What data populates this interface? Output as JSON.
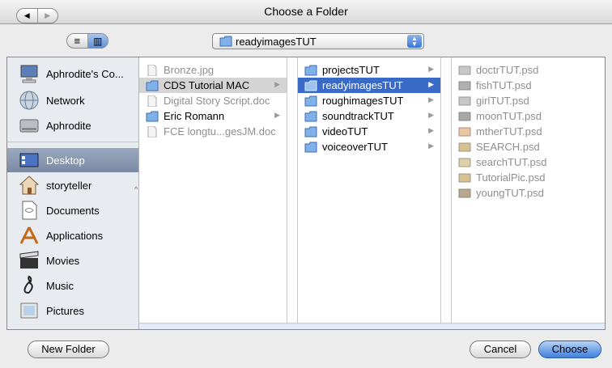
{
  "window": {
    "title": "Choose a Folder"
  },
  "toolbar": {
    "back_glyph": "◀",
    "forward_glyph": "▶",
    "list_view_glyph": "≡",
    "column_view_glyph": "▥",
    "path_popup": {
      "selected": "readyimagesTUT",
      "icon": "folder-icon"
    }
  },
  "sidebar": {
    "items": [
      {
        "label": "Aphrodite's Co...",
        "icon": "computer-icon"
      },
      {
        "label": "Network",
        "icon": "network-globe-icon"
      },
      {
        "label": "Aphrodite",
        "icon": "hard-disk-icon"
      },
      {
        "label": "Desktop",
        "icon": "desktop-icon",
        "selected": true
      },
      {
        "label": "storyteller",
        "icon": "home-icon"
      },
      {
        "label": "Documents",
        "icon": "documents-icon"
      },
      {
        "label": "Applications",
        "icon": "applications-icon"
      },
      {
        "label": "Movies",
        "icon": "movies-icon"
      },
      {
        "label": "Music",
        "icon": "music-icon"
      },
      {
        "label": "Pictures",
        "icon": "pictures-icon"
      }
    ]
  },
  "columns": [
    {
      "items": [
        {
          "label": "Bronze.jpg",
          "type": "file",
          "dim": true
        },
        {
          "label": "CDS Tutorial MAC",
          "type": "folder",
          "state": "selected-inactive",
          "arrow": "▶"
        },
        {
          "label": "Digital Story Script.doc",
          "type": "file",
          "dim": true
        },
        {
          "label": "Eric Romann",
          "type": "folder",
          "arrow": "▶"
        },
        {
          "label": "FCE longtu...gesJM.doc",
          "type": "file",
          "dim": true
        }
      ]
    },
    {
      "items": [
        {
          "label": "projectsTUT",
          "type": "folder",
          "arrow": "▶"
        },
        {
          "label": "readyimagesTUT",
          "type": "folder",
          "state": "selected",
          "arrow": "▶"
        },
        {
          "label": "roughimagesTUT",
          "type": "folder",
          "arrow": "▶"
        },
        {
          "label": "soundtrackTUT",
          "type": "folder",
          "arrow": "▶"
        },
        {
          "label": "videoTUT",
          "type": "folder",
          "arrow": "▶"
        },
        {
          "label": "voiceoverTUT",
          "type": "folder",
          "arrow": "▶"
        }
      ]
    },
    {
      "items": [
        {
          "label": "doctrTUT.psd",
          "type": "image",
          "dim": true
        },
        {
          "label": "fishTUT.psd",
          "type": "image",
          "dim": true
        },
        {
          "label": "girlTUT.psd",
          "type": "image",
          "dim": true
        },
        {
          "label": "moonTUT.psd",
          "type": "image",
          "dim": true
        },
        {
          "label": "mtherTUT.psd",
          "type": "image",
          "dim": true
        },
        {
          "label": "SEARCH.psd",
          "type": "image",
          "dim": true
        },
        {
          "label": "searchTUT.psd",
          "type": "image",
          "dim": true
        },
        {
          "label": "TutorialPic.psd",
          "type": "image",
          "dim": true
        },
        {
          "label": "youngTUT.psd",
          "type": "image",
          "dim": true
        }
      ]
    }
  ],
  "footer": {
    "new_folder_label": "New Folder",
    "cancel_label": "Cancel",
    "choose_label": "Choose"
  },
  "colors": {
    "selection_blue": "#3a6ac8",
    "sidebar_selected": "#8593ab",
    "default_button": "#3f80dd"
  }
}
